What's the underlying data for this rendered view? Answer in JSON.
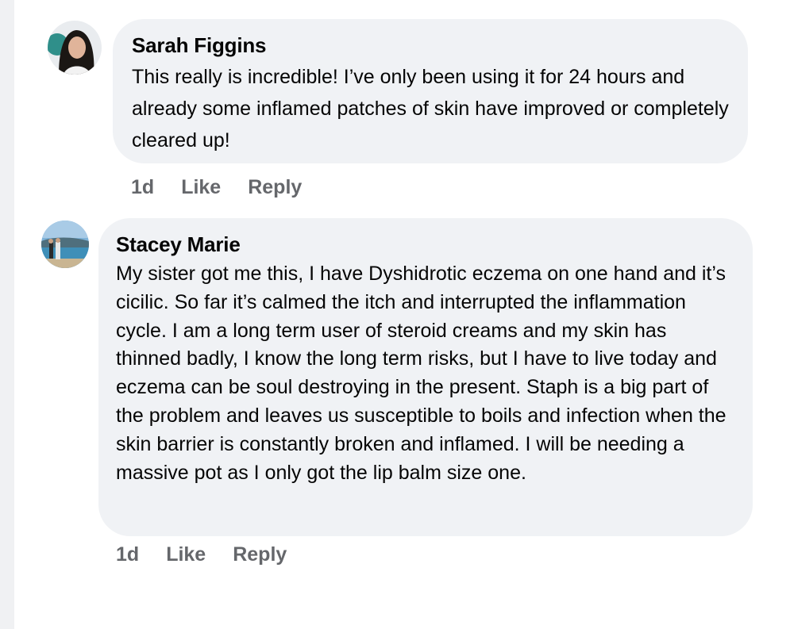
{
  "comments": [
    {
      "author": "Sarah Figgins",
      "text": "This really is incredible! I’ve only been using it for 24 hours and already some inflamed patches of skin have improved or completely cleared up!",
      "time": "1d",
      "like_label": "Like",
      "reply_label": "Reply"
    },
    {
      "author": "Stacey Marie",
      "text": "My sister got me this, I have Dyshidrotic eczema on one hand and it’s cicilic. So far it’s calmed the itch and interrupted the inflammation cycle. I am a long term user of steroid creams and my skin has thinned badly, I know the long term risks, but I have to live today and eczema can be soul destroying in the present. Staph is a big part of the problem and leaves us susceptible to boils and infection when the skin barrier is constantly broken and inflamed. I will be needing a massive pot as I only got the lip balm size one.",
      "time": "1d",
      "like_label": "Like",
      "reply_label": "Reply"
    }
  ],
  "colors": {
    "bubble": "#f0f2f5",
    "text": "#050505",
    "secondary": "#65676b"
  }
}
